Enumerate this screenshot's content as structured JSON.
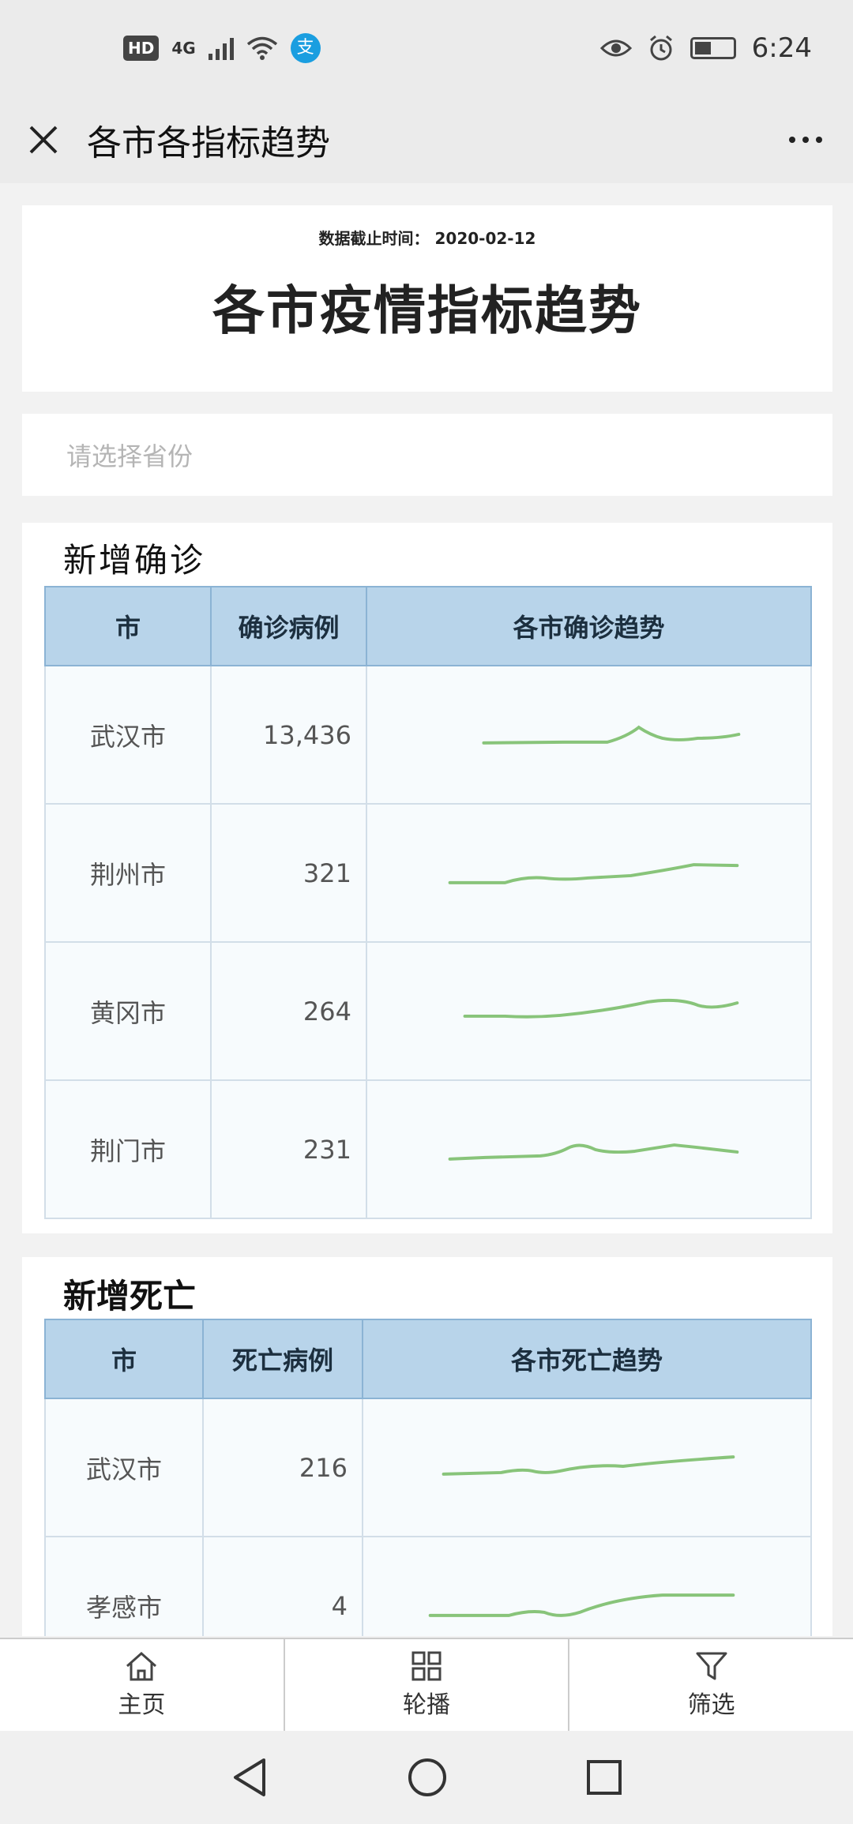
{
  "status_bar": {
    "hd": "HD",
    "network": "4G",
    "time": "6:24"
  },
  "app_bar": {
    "title": "各市各指标趋势"
  },
  "header": {
    "data_date": "数据截止时间： 2020-02-12",
    "heading": "各市疫情指标趋势"
  },
  "province_select": {
    "placeholder": "请选择省份"
  },
  "confirmed": {
    "title": "新增确诊",
    "columns": [
      "市",
      "确诊病例",
      "各市确诊趋势"
    ],
    "rows": [
      {
        "city": "武汉市",
        "value": "13,436"
      },
      {
        "city": "荆州市",
        "value": "321"
      },
      {
        "city": "黄冈市",
        "value": "264"
      },
      {
        "city": "荆门市",
        "value": "231"
      }
    ]
  },
  "deaths": {
    "title": "新增死亡",
    "columns": [
      "市",
      "死亡病例",
      "各市死亡趋势"
    ],
    "rows": [
      {
        "city": "武汉市",
        "value": "216"
      },
      {
        "city": "孝感市",
        "value": "4"
      }
    ]
  },
  "bottom_nav": {
    "items": [
      {
        "label": "主页",
        "icon": "home-icon"
      },
      {
        "label": "轮播",
        "icon": "grid-icon"
      },
      {
        "label": "筛选",
        "icon": "filter-icon"
      }
    ]
  },
  "colors": {
    "sparkline": "#88c47a",
    "table_header_bg": "#b8d4ea",
    "table_header_border": "#8bb3d4"
  }
}
